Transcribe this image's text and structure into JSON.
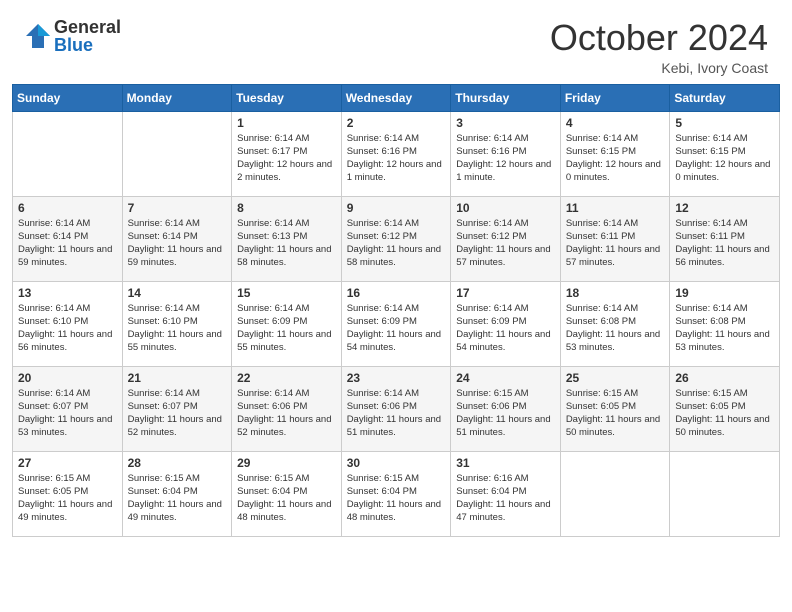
{
  "logo": {
    "general": "General",
    "blue": "Blue"
  },
  "title": "October 2024",
  "location": "Kebi, Ivory Coast",
  "days_of_week": [
    "Sunday",
    "Monday",
    "Tuesday",
    "Wednesday",
    "Thursday",
    "Friday",
    "Saturday"
  ],
  "weeks": [
    [
      {
        "day": "",
        "info": ""
      },
      {
        "day": "",
        "info": ""
      },
      {
        "day": "1",
        "info": "Sunrise: 6:14 AM\nSunset: 6:17 PM\nDaylight: 12 hours and 2 minutes."
      },
      {
        "day": "2",
        "info": "Sunrise: 6:14 AM\nSunset: 6:16 PM\nDaylight: 12 hours and 1 minute."
      },
      {
        "day": "3",
        "info": "Sunrise: 6:14 AM\nSunset: 6:16 PM\nDaylight: 12 hours and 1 minute."
      },
      {
        "day": "4",
        "info": "Sunrise: 6:14 AM\nSunset: 6:15 PM\nDaylight: 12 hours and 0 minutes."
      },
      {
        "day": "5",
        "info": "Sunrise: 6:14 AM\nSunset: 6:15 PM\nDaylight: 12 hours and 0 minutes."
      }
    ],
    [
      {
        "day": "6",
        "info": "Sunrise: 6:14 AM\nSunset: 6:14 PM\nDaylight: 11 hours and 59 minutes."
      },
      {
        "day": "7",
        "info": "Sunrise: 6:14 AM\nSunset: 6:14 PM\nDaylight: 11 hours and 59 minutes."
      },
      {
        "day": "8",
        "info": "Sunrise: 6:14 AM\nSunset: 6:13 PM\nDaylight: 11 hours and 58 minutes."
      },
      {
        "day": "9",
        "info": "Sunrise: 6:14 AM\nSunset: 6:12 PM\nDaylight: 11 hours and 58 minutes."
      },
      {
        "day": "10",
        "info": "Sunrise: 6:14 AM\nSunset: 6:12 PM\nDaylight: 11 hours and 57 minutes."
      },
      {
        "day": "11",
        "info": "Sunrise: 6:14 AM\nSunset: 6:11 PM\nDaylight: 11 hours and 57 minutes."
      },
      {
        "day": "12",
        "info": "Sunrise: 6:14 AM\nSunset: 6:11 PM\nDaylight: 11 hours and 56 minutes."
      }
    ],
    [
      {
        "day": "13",
        "info": "Sunrise: 6:14 AM\nSunset: 6:10 PM\nDaylight: 11 hours and 56 minutes."
      },
      {
        "day": "14",
        "info": "Sunrise: 6:14 AM\nSunset: 6:10 PM\nDaylight: 11 hours and 55 minutes."
      },
      {
        "day": "15",
        "info": "Sunrise: 6:14 AM\nSunset: 6:09 PM\nDaylight: 11 hours and 55 minutes."
      },
      {
        "day": "16",
        "info": "Sunrise: 6:14 AM\nSunset: 6:09 PM\nDaylight: 11 hours and 54 minutes."
      },
      {
        "day": "17",
        "info": "Sunrise: 6:14 AM\nSunset: 6:09 PM\nDaylight: 11 hours and 54 minutes."
      },
      {
        "day": "18",
        "info": "Sunrise: 6:14 AM\nSunset: 6:08 PM\nDaylight: 11 hours and 53 minutes."
      },
      {
        "day": "19",
        "info": "Sunrise: 6:14 AM\nSunset: 6:08 PM\nDaylight: 11 hours and 53 minutes."
      }
    ],
    [
      {
        "day": "20",
        "info": "Sunrise: 6:14 AM\nSunset: 6:07 PM\nDaylight: 11 hours and 53 minutes."
      },
      {
        "day": "21",
        "info": "Sunrise: 6:14 AM\nSunset: 6:07 PM\nDaylight: 11 hours and 52 minutes."
      },
      {
        "day": "22",
        "info": "Sunrise: 6:14 AM\nSunset: 6:06 PM\nDaylight: 11 hours and 52 minutes."
      },
      {
        "day": "23",
        "info": "Sunrise: 6:14 AM\nSunset: 6:06 PM\nDaylight: 11 hours and 51 minutes."
      },
      {
        "day": "24",
        "info": "Sunrise: 6:15 AM\nSunset: 6:06 PM\nDaylight: 11 hours and 51 minutes."
      },
      {
        "day": "25",
        "info": "Sunrise: 6:15 AM\nSunset: 6:05 PM\nDaylight: 11 hours and 50 minutes."
      },
      {
        "day": "26",
        "info": "Sunrise: 6:15 AM\nSunset: 6:05 PM\nDaylight: 11 hours and 50 minutes."
      }
    ],
    [
      {
        "day": "27",
        "info": "Sunrise: 6:15 AM\nSunset: 6:05 PM\nDaylight: 11 hours and 49 minutes."
      },
      {
        "day": "28",
        "info": "Sunrise: 6:15 AM\nSunset: 6:04 PM\nDaylight: 11 hours and 49 minutes."
      },
      {
        "day": "29",
        "info": "Sunrise: 6:15 AM\nSunset: 6:04 PM\nDaylight: 11 hours and 48 minutes."
      },
      {
        "day": "30",
        "info": "Sunrise: 6:15 AM\nSunset: 6:04 PM\nDaylight: 11 hours and 48 minutes."
      },
      {
        "day": "31",
        "info": "Sunrise: 6:16 AM\nSunset: 6:04 PM\nDaylight: 11 hours and 47 minutes."
      },
      {
        "day": "",
        "info": ""
      },
      {
        "day": "",
        "info": ""
      }
    ]
  ]
}
